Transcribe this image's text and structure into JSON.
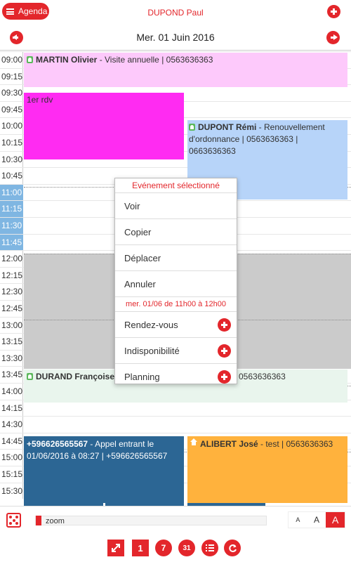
{
  "header": {
    "agenda_label": "Agenda",
    "user_name": "DUPOND Paul",
    "date_title": "Mer. 01 Juin 2016"
  },
  "times": [
    "09:00",
    "09:15",
    "09:30",
    "09:45",
    "10:00",
    "10:15",
    "10:30",
    "10:45",
    "11:00",
    "11:15",
    "11:30",
    "11:45",
    "12:00",
    "12:15",
    "12:30",
    "12:45",
    "13:00",
    "13:15",
    "13:30",
    "13:45",
    "14:00",
    "14:15",
    "14:30",
    "14:45",
    "15:00",
    "15:15",
    "15:30"
  ],
  "highlighted_times": [
    "11:00",
    "11:15",
    "11:30",
    "11:45"
  ],
  "events": {
    "martin": {
      "name": "MARTIN Olivier",
      "detail": " - Visite annuelle | 0563636363"
    },
    "first_rdv": {
      "detail": "1er rdv"
    },
    "dupont": {
      "name": "DUPONT Rémi",
      "detail": " - Renouvellement d'ordonnance | 0563636363 | 0663636363"
    },
    "durand": {
      "name": "DURAND Françoise",
      "detail": "0563636363"
    },
    "call": {
      "name": "+596626565567",
      "detail": " - Appel entrant le 01/06/2016 à 08:27 | +596626565567"
    },
    "alibert": {
      "name": "ALIBERT José",
      "detail": " - test | 0563636363"
    }
  },
  "menu": {
    "title": "Evénement sélectionné",
    "items": [
      "Voir",
      "Copier",
      "Déplacer",
      "Annuler"
    ],
    "subtitle": "mer. 01/06 de 11h00 à 12h00",
    "create_items": [
      "Rendez-vous",
      "Indisponibilité",
      "Planning"
    ]
  },
  "footer": {
    "zoom_label": "zoom",
    "font_sizes": [
      "A",
      "A",
      "A"
    ],
    "day_label": "1",
    "week_label": "7",
    "month_label": "31"
  },
  "colors": {
    "accent": "#e3262b",
    "martin": "#fdc9fb",
    "first_rdv": "#ff2bf2",
    "dupont": "#b7d4f9",
    "durand": "#e9f5ed",
    "call": "#2c6694",
    "alibert": "#ffb23d"
  }
}
